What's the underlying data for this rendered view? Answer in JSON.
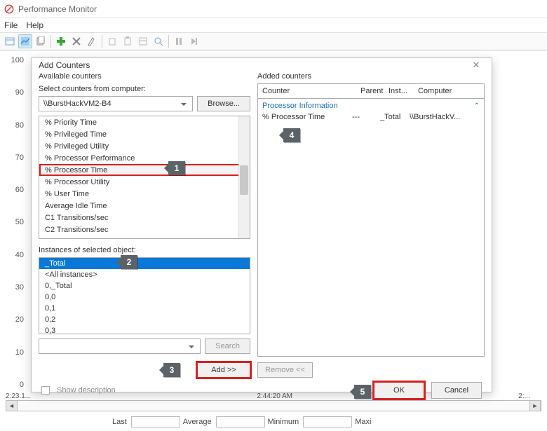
{
  "app": {
    "title": "Performance Monitor"
  },
  "menu": {
    "file": "File",
    "help": "Help"
  },
  "chart": {
    "y_ticks": [
      "100",
      "90",
      "80",
      "70",
      "60",
      "50",
      "40",
      "30",
      "20",
      "10",
      "0"
    ],
    "x_left": "2:23:1...",
    "x_mid": "2:44:20 AM",
    "x_right": "2:..."
  },
  "stats": {
    "last": "Last",
    "avg": "Average",
    "min": "Minimum",
    "max": "Maxi"
  },
  "dialog": {
    "title": "Add Counters",
    "available_label": "Available counters",
    "select_from": "Select counters from computer:",
    "computer": "\\\\BurstHackVM2-B4",
    "browse": "Browse...",
    "counters": [
      "% Priority Time",
      "% Privileged Time",
      "% Privileged Utility",
      "% Processor Performance",
      "% Processor Time",
      "% Processor Utility",
      "% User Time",
      "Average Idle Time",
      "C1 Transitions/sec",
      "C2 Transitions/sec"
    ],
    "highlighted_counter_index": 4,
    "instances_label": "Instances of selected object:",
    "instances": [
      "_Total",
      "<All instances>",
      "0,_Total",
      "0,0",
      "0,1",
      "0,2",
      "0,3"
    ],
    "search": "Search",
    "add": "Add >>",
    "added_label": "Added counters",
    "col_counter": "Counter",
    "col_parent": "Parent",
    "col_inst": "Inst...",
    "col_comp": "Computer",
    "group": "Processor Information",
    "added_row": {
      "counter": "% Processor Time",
      "parent": "---",
      "inst": "_Total",
      "comp": "\\\\BurstHackV..."
    },
    "remove": "Remove <<",
    "show_desc": "Show description",
    "ok": "OK",
    "cancel": "Cancel"
  },
  "badges": {
    "b1": "1",
    "b2": "2",
    "b3": "3",
    "b4": "4",
    "b5": "5"
  }
}
